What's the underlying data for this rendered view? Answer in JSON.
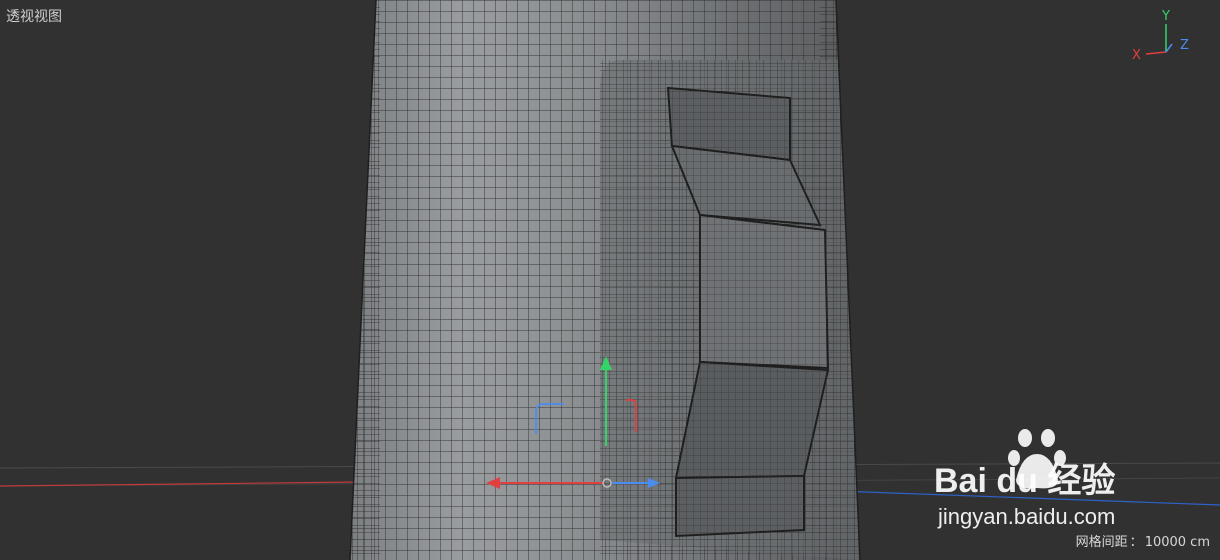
{
  "viewport": {
    "title": "透视视图",
    "grid_spacing_label": "网格间距",
    "grid_spacing_value": "10000 cm"
  },
  "axes": {
    "x_label": "X",
    "y_label": "Y",
    "z_label": "Z",
    "x_color": "#e04040",
    "y_color": "#34d36a",
    "z_color": "#4a8cf0"
  },
  "watermark": {
    "brand_text": "Bai du 经验",
    "url": "jingyan.baidu.com"
  }
}
